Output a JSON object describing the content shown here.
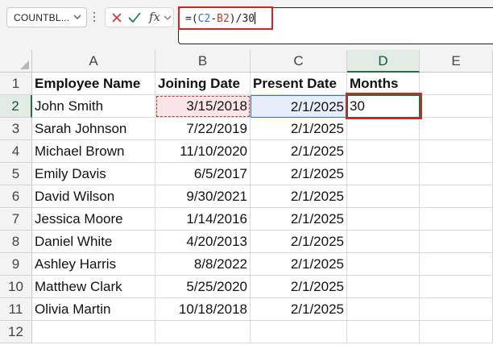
{
  "name_box": {
    "value": "COUNTBL..."
  },
  "formula_bar": {
    "prefix": "=(",
    "ref1": "C2",
    "op1": "-",
    "ref2": "B2",
    "suffix": ")/30",
    "fx_label": "fx",
    "cancel_icon": "x-icon",
    "enter_icon": "check-icon"
  },
  "columns": [
    "A",
    "B",
    "C",
    "D",
    "E"
  ],
  "rows": [
    "1",
    "2",
    "3",
    "4",
    "5",
    "6",
    "7",
    "8",
    "9",
    "10",
    "11",
    "12"
  ],
  "table": {
    "headers": [
      "Employee Name",
      "Joining Date",
      "Present Date",
      "Months"
    ],
    "data": [
      [
        "John Smith",
        "3/15/2018",
        "2/1/2025",
        "30"
      ],
      [
        "Sarah Johnson",
        "7/22/2019",
        "2/1/2025",
        ""
      ],
      [
        "Michael Brown",
        "11/10/2020",
        "2/1/2025",
        ""
      ],
      [
        "Emily Davis",
        "6/5/2017",
        "2/1/2025",
        ""
      ],
      [
        "David Wilson",
        "9/30/2021",
        "2/1/2025",
        ""
      ],
      [
        "Jessica Moore",
        "1/14/2016",
        "2/1/2025",
        ""
      ],
      [
        "Daniel White",
        "4/20/2013",
        "2/1/2025",
        ""
      ],
      [
        "Ashley Harris",
        "8/8/2022",
        "2/1/2025",
        ""
      ],
      [
        "Matthew Clark",
        "5/25/2020",
        "2/1/2025",
        ""
      ],
      [
        "Olivia Martin",
        "10/18/2018",
        "2/1/2025",
        ""
      ]
    ]
  },
  "colors": {
    "accent": "#1e7145",
    "highlight": "#e02020",
    "ref_b": "#c0392b",
    "ref_c": "#2e6fd1"
  }
}
